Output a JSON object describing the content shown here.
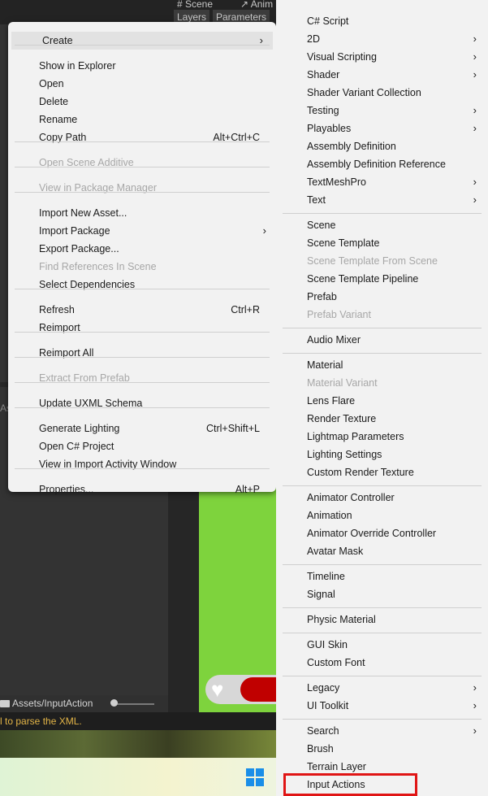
{
  "background": {
    "tabs": [
      {
        "label": "# Scene"
      },
      {
        "label": "↗ Anim"
      }
    ],
    "subtabs": [
      {
        "label": "Layers"
      },
      {
        "label": "Parameters"
      }
    ],
    "left_label": "As",
    "path_label": "Assets/InputAction",
    "console_text": "l to parse the XML."
  },
  "context_menu": {
    "items": [
      {
        "label": "Create",
        "shortcut": "",
        "has_submenu": true,
        "disabled": false,
        "highlighted": true
      },
      {
        "label": "Show in Explorer",
        "shortcut": "",
        "has_submenu": false,
        "disabled": false
      },
      {
        "label": "Open",
        "shortcut": "",
        "has_submenu": false,
        "disabled": false
      },
      {
        "label": "Delete",
        "shortcut": "",
        "has_submenu": false,
        "disabled": false
      },
      {
        "label": "Rename",
        "shortcut": "",
        "has_submenu": false,
        "disabled": false
      },
      {
        "label": "Copy Path",
        "shortcut": "Alt+Ctrl+C",
        "has_submenu": false,
        "disabled": false
      },
      {
        "label": "Open Scene Additive",
        "shortcut": "",
        "has_submenu": false,
        "disabled": true
      },
      {
        "label": "View in Package Manager",
        "shortcut": "",
        "has_submenu": false,
        "disabled": true
      },
      {
        "label": "Import New Asset...",
        "shortcut": "",
        "has_submenu": false,
        "disabled": false
      },
      {
        "label": "Import Package",
        "shortcut": "",
        "has_submenu": true,
        "disabled": false
      },
      {
        "label": "Export Package...",
        "shortcut": "",
        "has_submenu": false,
        "disabled": false
      },
      {
        "label": "Find References In Scene",
        "shortcut": "",
        "has_submenu": false,
        "disabled": true
      },
      {
        "label": "Select Dependencies",
        "shortcut": "",
        "has_submenu": false,
        "disabled": false
      },
      {
        "label": "Refresh",
        "shortcut": "Ctrl+R",
        "has_submenu": false,
        "disabled": false
      },
      {
        "label": "Reimport",
        "shortcut": "",
        "has_submenu": false,
        "disabled": false
      },
      {
        "label": "Reimport All",
        "shortcut": "",
        "has_submenu": false,
        "disabled": false
      },
      {
        "label": "Extract From Prefab",
        "shortcut": "",
        "has_submenu": false,
        "disabled": true
      },
      {
        "label": "Update UXML Schema",
        "shortcut": "",
        "has_submenu": false,
        "disabled": false
      },
      {
        "label": "Generate Lighting",
        "shortcut": "Ctrl+Shift+L",
        "has_submenu": false,
        "disabled": false
      },
      {
        "label": "Open C# Project",
        "shortcut": "",
        "has_submenu": false,
        "disabled": false
      },
      {
        "label": "View in Import Activity Window",
        "shortcut": "",
        "has_submenu": false,
        "disabled": false
      },
      {
        "label": "Properties...",
        "shortcut": "Alt+P",
        "has_submenu": false,
        "disabled": false
      }
    ]
  },
  "create_submenu": {
    "items": [
      {
        "label": "C# Script",
        "has_submenu": false,
        "disabled": false
      },
      {
        "label": "2D",
        "has_submenu": true,
        "disabled": false
      },
      {
        "label": "Visual Scripting",
        "has_submenu": true,
        "disabled": false
      },
      {
        "label": "Shader",
        "has_submenu": true,
        "disabled": false
      },
      {
        "label": "Shader Variant Collection",
        "has_submenu": false,
        "disabled": false
      },
      {
        "label": "Testing",
        "has_submenu": true,
        "disabled": false
      },
      {
        "label": "Playables",
        "has_submenu": true,
        "disabled": false
      },
      {
        "label": "Assembly Definition",
        "has_submenu": false,
        "disabled": false
      },
      {
        "label": "Assembly Definition Reference",
        "has_submenu": false,
        "disabled": false
      },
      {
        "label": "TextMeshPro",
        "has_submenu": true,
        "disabled": false
      },
      {
        "label": "Text",
        "has_submenu": true,
        "disabled": false
      },
      {
        "label": "Scene",
        "has_submenu": false,
        "disabled": false
      },
      {
        "label": "Scene Template",
        "has_submenu": false,
        "disabled": false
      },
      {
        "label": "Scene Template From Scene",
        "has_submenu": false,
        "disabled": true
      },
      {
        "label": "Scene Template Pipeline",
        "has_submenu": false,
        "disabled": false
      },
      {
        "label": "Prefab",
        "has_submenu": false,
        "disabled": false
      },
      {
        "label": "Prefab Variant",
        "has_submenu": false,
        "disabled": true
      },
      {
        "label": "Audio Mixer",
        "has_submenu": false,
        "disabled": false
      },
      {
        "label": "Material",
        "has_submenu": false,
        "disabled": false
      },
      {
        "label": "Material Variant",
        "has_submenu": false,
        "disabled": true
      },
      {
        "label": "Lens Flare",
        "has_submenu": false,
        "disabled": false
      },
      {
        "label": "Render Texture",
        "has_submenu": false,
        "disabled": false
      },
      {
        "label": "Lightmap Parameters",
        "has_submenu": false,
        "disabled": false
      },
      {
        "label": "Lighting Settings",
        "has_submenu": false,
        "disabled": false
      },
      {
        "label": "Custom Render Texture",
        "has_submenu": false,
        "disabled": false
      },
      {
        "label": "Animator Controller",
        "has_submenu": false,
        "disabled": false
      },
      {
        "label": "Animation",
        "has_submenu": false,
        "disabled": false
      },
      {
        "label": "Animator Override Controller",
        "has_submenu": false,
        "disabled": false
      },
      {
        "label": "Avatar Mask",
        "has_submenu": false,
        "disabled": false
      },
      {
        "label": "Timeline",
        "has_submenu": false,
        "disabled": false
      },
      {
        "label": "Signal",
        "has_submenu": false,
        "disabled": false
      },
      {
        "label": "Physic Material",
        "has_submenu": false,
        "disabled": false
      },
      {
        "label": "GUI Skin",
        "has_submenu": false,
        "disabled": false
      },
      {
        "label": "Custom Font",
        "has_submenu": false,
        "disabled": false
      },
      {
        "label": "Legacy",
        "has_submenu": true,
        "disabled": false
      },
      {
        "label": "UI Toolkit",
        "has_submenu": true,
        "disabled": false
      },
      {
        "label": "Search",
        "has_submenu": true,
        "disabled": false
      },
      {
        "label": "Brush",
        "has_submenu": false,
        "disabled": false
      },
      {
        "label": "Terrain Layer",
        "has_submenu": false,
        "disabled": false
      },
      {
        "label": "Input Actions",
        "has_submenu": false,
        "disabled": false,
        "outlined": true
      }
    ]
  },
  "colors": {
    "menu_bg": "#f2f2f2",
    "highlight_outline": "#e01515",
    "console_text": "#e2b447",
    "accent_green": "#7ed33d"
  }
}
